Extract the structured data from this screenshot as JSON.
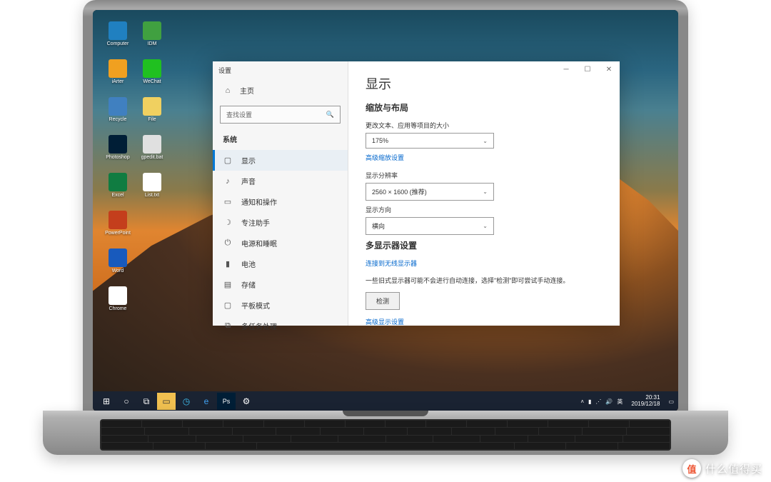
{
  "window": {
    "title": "设置"
  },
  "home_label": "主页",
  "search": {
    "placeholder": "查找设置"
  },
  "category": "系统",
  "nav": [
    {
      "label": "显示",
      "active": true
    },
    {
      "label": "声音"
    },
    {
      "label": "通知和操作"
    },
    {
      "label": "专注助手"
    },
    {
      "label": "电源和睡眠"
    },
    {
      "label": "电池"
    },
    {
      "label": "存储"
    },
    {
      "label": "平板模式"
    },
    {
      "label": "多任务处理"
    }
  ],
  "display": {
    "heading": "显示",
    "section1": "缩放与布局",
    "scale_label": "更改文本、应用等项目的大小",
    "scale_value": "175%",
    "adv_scale": "高级缩放设置",
    "res_label": "显示分辨率",
    "res_value": "2560 × 1600 (推荐)",
    "orient_label": "显示方向",
    "orient_value": "横向",
    "section2": "多显示器设置",
    "wireless": "连接到无线显示器",
    "detect_note": "一些旧式显示器可能不会进行自动连接，选择\"检测\"即可尝试手动连接。",
    "detect_btn": "检测",
    "adv_display": "高级显示设置"
  },
  "desktop_icons": [
    {
      "label": "Computer",
      "bg": "#2080c0"
    },
    {
      "label": "IDM",
      "bg": "#40a040"
    },
    {
      "label": "iArter",
      "bg": "#f0a020"
    },
    {
      "label": "WeChat",
      "bg": "#20c020"
    },
    {
      "label": "Recycle",
      "bg": "#4080c0"
    },
    {
      "label": "File",
      "bg": "#f0d060"
    },
    {
      "label": "Photoshop",
      "bg": "#001e36"
    },
    {
      "label": "gpedit.bat",
      "bg": "#e0e0e0"
    },
    {
      "label": "Excel",
      "bg": "#107c41"
    },
    {
      "label": "List.txt",
      "bg": "#ffffff"
    },
    {
      "label": "PowerPoint",
      "bg": "#c43e1c"
    },
    {
      "label": ""
    },
    {
      "label": "Word",
      "bg": "#185abd"
    },
    {
      "label": ""
    },
    {
      "label": "Chrome",
      "bg": "#ffffff"
    }
  ],
  "taskbar": {
    "ime": "英",
    "time": "20:31",
    "date": "2019/12/18"
  },
  "watermark": {
    "badge": "值",
    "text": "什么值得买"
  }
}
